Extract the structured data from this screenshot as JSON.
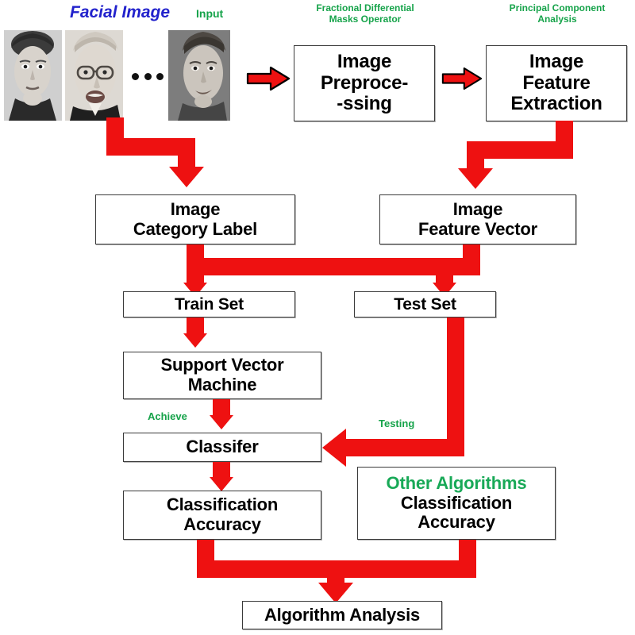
{
  "diagram": {
    "title_blue": "Facial Image",
    "captions": {
      "input": "Input",
      "fdmo_line1": "Fractional Differential",
      "fdmo_line2": "Masks Operator",
      "pca_line1": "Principal Component",
      "pca_line2": "Analysis",
      "achieve": "Achieve",
      "testing": "Testing"
    },
    "boxes": {
      "preprocessing": {
        "line1": "Image",
        "line2": "Preproce-",
        "line3": "-ssing"
      },
      "feature_extraction": {
        "line1": "Image",
        "line2": "Feature",
        "line3": "Extraction"
      },
      "category_label": {
        "line1": "Image",
        "line2": "Category Label"
      },
      "feature_vector": {
        "line1": "Image",
        "line2": "Feature Vector"
      },
      "train_set": {
        "line1": "Train Set"
      },
      "test_set": {
        "line1": "Test Set"
      },
      "svm": {
        "line1": "Support Vector",
        "line2": "Machine"
      },
      "classifier": {
        "line1": "Classifer"
      },
      "classification_accuracy": {
        "line1": "Classification",
        "line2": "Accuracy"
      },
      "other_classification_accuracy": {
        "line1": "Other Algorithms",
        "line2": "Classification",
        "line3": "Accuracy"
      },
      "algorithm_analysis": {
        "line1": "Algorithm Analysis"
      }
    },
    "colors": {
      "arrow_red": "#ee1111",
      "caption_green": "#16a34a",
      "title_blue": "#2222cc",
      "highlight_green": "#18a957",
      "box_border": "#3a3a3a",
      "text_black": "#000000"
    }
  }
}
